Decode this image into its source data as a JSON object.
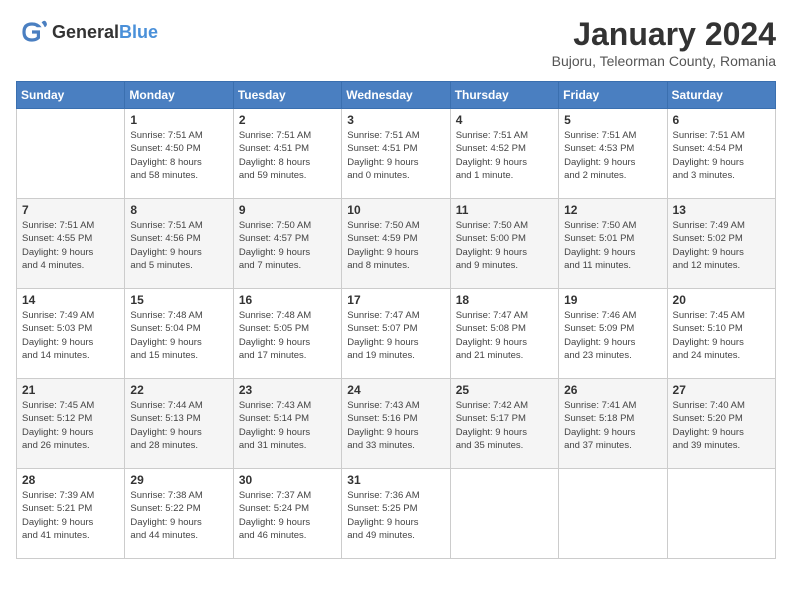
{
  "logo": {
    "general": "General",
    "blue": "Blue"
  },
  "title": "January 2024",
  "subtitle": "Bujoru, Teleorman County, Romania",
  "headers": [
    "Sunday",
    "Monday",
    "Tuesday",
    "Wednesday",
    "Thursday",
    "Friday",
    "Saturday"
  ],
  "weeks": [
    [
      {
        "day": "",
        "info": ""
      },
      {
        "day": "1",
        "info": "Sunrise: 7:51 AM\nSunset: 4:50 PM\nDaylight: 8 hours\nand 58 minutes."
      },
      {
        "day": "2",
        "info": "Sunrise: 7:51 AM\nSunset: 4:51 PM\nDaylight: 8 hours\nand 59 minutes."
      },
      {
        "day": "3",
        "info": "Sunrise: 7:51 AM\nSunset: 4:51 PM\nDaylight: 9 hours\nand 0 minutes."
      },
      {
        "day": "4",
        "info": "Sunrise: 7:51 AM\nSunset: 4:52 PM\nDaylight: 9 hours\nand 1 minute."
      },
      {
        "day": "5",
        "info": "Sunrise: 7:51 AM\nSunset: 4:53 PM\nDaylight: 9 hours\nand 2 minutes."
      },
      {
        "day": "6",
        "info": "Sunrise: 7:51 AM\nSunset: 4:54 PM\nDaylight: 9 hours\nand 3 minutes."
      }
    ],
    [
      {
        "day": "7",
        "info": "Sunrise: 7:51 AM\nSunset: 4:55 PM\nDaylight: 9 hours\nand 4 minutes."
      },
      {
        "day": "8",
        "info": "Sunrise: 7:51 AM\nSunset: 4:56 PM\nDaylight: 9 hours\nand 5 minutes."
      },
      {
        "day": "9",
        "info": "Sunrise: 7:50 AM\nSunset: 4:57 PM\nDaylight: 9 hours\nand 7 minutes."
      },
      {
        "day": "10",
        "info": "Sunrise: 7:50 AM\nSunset: 4:59 PM\nDaylight: 9 hours\nand 8 minutes."
      },
      {
        "day": "11",
        "info": "Sunrise: 7:50 AM\nSunset: 5:00 PM\nDaylight: 9 hours\nand 9 minutes."
      },
      {
        "day": "12",
        "info": "Sunrise: 7:50 AM\nSunset: 5:01 PM\nDaylight: 9 hours\nand 11 minutes."
      },
      {
        "day": "13",
        "info": "Sunrise: 7:49 AM\nSunset: 5:02 PM\nDaylight: 9 hours\nand 12 minutes."
      }
    ],
    [
      {
        "day": "14",
        "info": "Sunrise: 7:49 AM\nSunset: 5:03 PM\nDaylight: 9 hours\nand 14 minutes."
      },
      {
        "day": "15",
        "info": "Sunrise: 7:48 AM\nSunset: 5:04 PM\nDaylight: 9 hours\nand 15 minutes."
      },
      {
        "day": "16",
        "info": "Sunrise: 7:48 AM\nSunset: 5:05 PM\nDaylight: 9 hours\nand 17 minutes."
      },
      {
        "day": "17",
        "info": "Sunrise: 7:47 AM\nSunset: 5:07 PM\nDaylight: 9 hours\nand 19 minutes."
      },
      {
        "day": "18",
        "info": "Sunrise: 7:47 AM\nSunset: 5:08 PM\nDaylight: 9 hours\nand 21 minutes."
      },
      {
        "day": "19",
        "info": "Sunrise: 7:46 AM\nSunset: 5:09 PM\nDaylight: 9 hours\nand 23 minutes."
      },
      {
        "day": "20",
        "info": "Sunrise: 7:45 AM\nSunset: 5:10 PM\nDaylight: 9 hours\nand 24 minutes."
      }
    ],
    [
      {
        "day": "21",
        "info": "Sunrise: 7:45 AM\nSunset: 5:12 PM\nDaylight: 9 hours\nand 26 minutes."
      },
      {
        "day": "22",
        "info": "Sunrise: 7:44 AM\nSunset: 5:13 PM\nDaylight: 9 hours\nand 28 minutes."
      },
      {
        "day": "23",
        "info": "Sunrise: 7:43 AM\nSunset: 5:14 PM\nDaylight: 9 hours\nand 31 minutes."
      },
      {
        "day": "24",
        "info": "Sunrise: 7:43 AM\nSunset: 5:16 PM\nDaylight: 9 hours\nand 33 minutes."
      },
      {
        "day": "25",
        "info": "Sunrise: 7:42 AM\nSunset: 5:17 PM\nDaylight: 9 hours\nand 35 minutes."
      },
      {
        "day": "26",
        "info": "Sunrise: 7:41 AM\nSunset: 5:18 PM\nDaylight: 9 hours\nand 37 minutes."
      },
      {
        "day": "27",
        "info": "Sunrise: 7:40 AM\nSunset: 5:20 PM\nDaylight: 9 hours\nand 39 minutes."
      }
    ],
    [
      {
        "day": "28",
        "info": "Sunrise: 7:39 AM\nSunset: 5:21 PM\nDaylight: 9 hours\nand 41 minutes."
      },
      {
        "day": "29",
        "info": "Sunrise: 7:38 AM\nSunset: 5:22 PM\nDaylight: 9 hours\nand 44 minutes."
      },
      {
        "day": "30",
        "info": "Sunrise: 7:37 AM\nSunset: 5:24 PM\nDaylight: 9 hours\nand 46 minutes."
      },
      {
        "day": "31",
        "info": "Sunrise: 7:36 AM\nSunset: 5:25 PM\nDaylight: 9 hours\nand 49 minutes."
      },
      {
        "day": "",
        "info": ""
      },
      {
        "day": "",
        "info": ""
      },
      {
        "day": "",
        "info": ""
      }
    ]
  ]
}
